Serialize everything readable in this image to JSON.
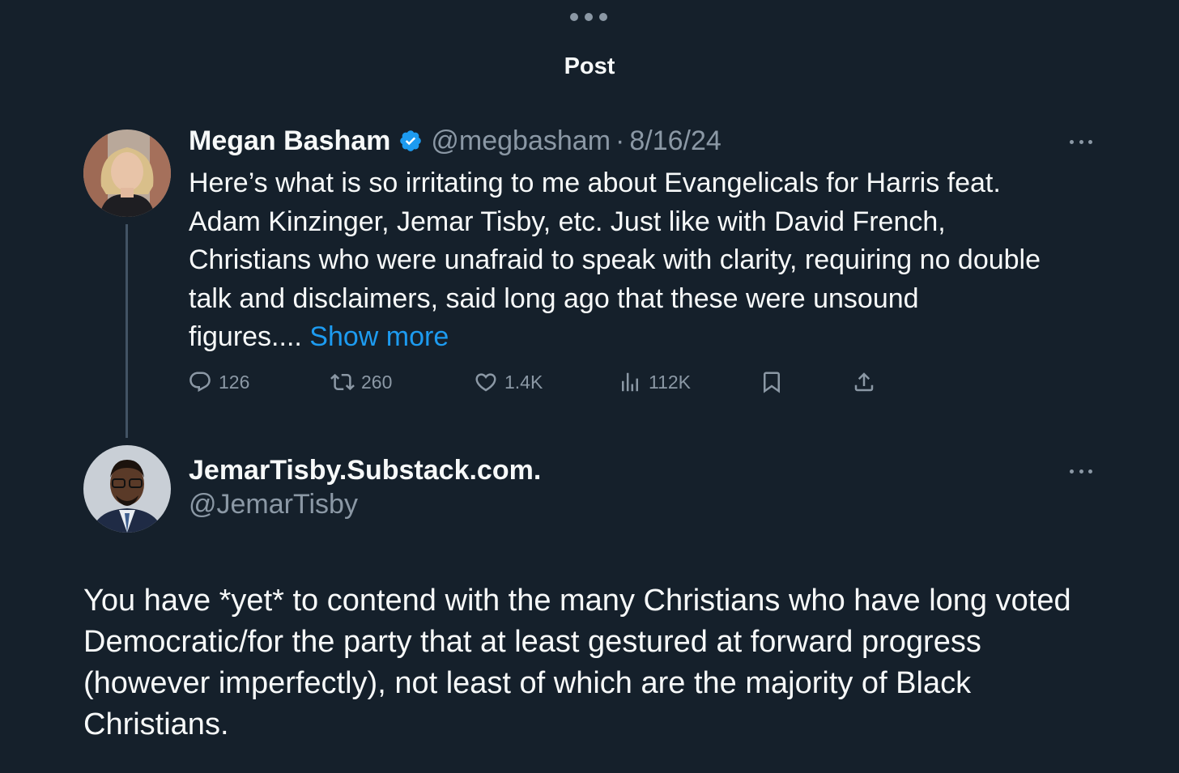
{
  "header": {
    "title": "Post"
  },
  "original_post": {
    "author": {
      "display_name": "Megan Basham",
      "verified": true,
      "handle": "@megbasham",
      "separator": "·",
      "date": "8/16/24"
    },
    "text_lines": [
      "Here’s what is so irritating to me about Evangelicals for Harris feat.",
      "Adam Kinzinger, Jemar Tisby, etc. Just like with David French,",
      "Christians who were unafraid to speak with clarity, requiring no double",
      "talk and disclaimers, said long ago that these were unsound",
      "figures.... "
    ],
    "show_more_label": "Show more",
    "metrics": {
      "replies": "126",
      "reposts": "260",
      "likes": "1.4K",
      "views": "112K"
    },
    "icons": [
      "reply-icon",
      "repost-icon",
      "like-icon",
      "views-icon",
      "bookmark-icon",
      "share-icon",
      "more-icon",
      "verified-badge-icon"
    ]
  },
  "reply_post": {
    "author": {
      "display_name": "JemarTisby.Substack.com.",
      "handle": "@JemarTisby"
    },
    "text_lines": [
      "You have *yet* to contend with the many Christians who have long voted",
      "Democratic/for the party that at least gestured at forward progress",
      "(however imperfectly), not least of which are the majority of Black",
      "Christians."
    ]
  },
  "colors": {
    "background": "#15202b",
    "primary_text": "#f7f9f9",
    "secondary_text": "#8b98a5",
    "accent": "#1d9bf0",
    "thread_line": "#425364"
  }
}
